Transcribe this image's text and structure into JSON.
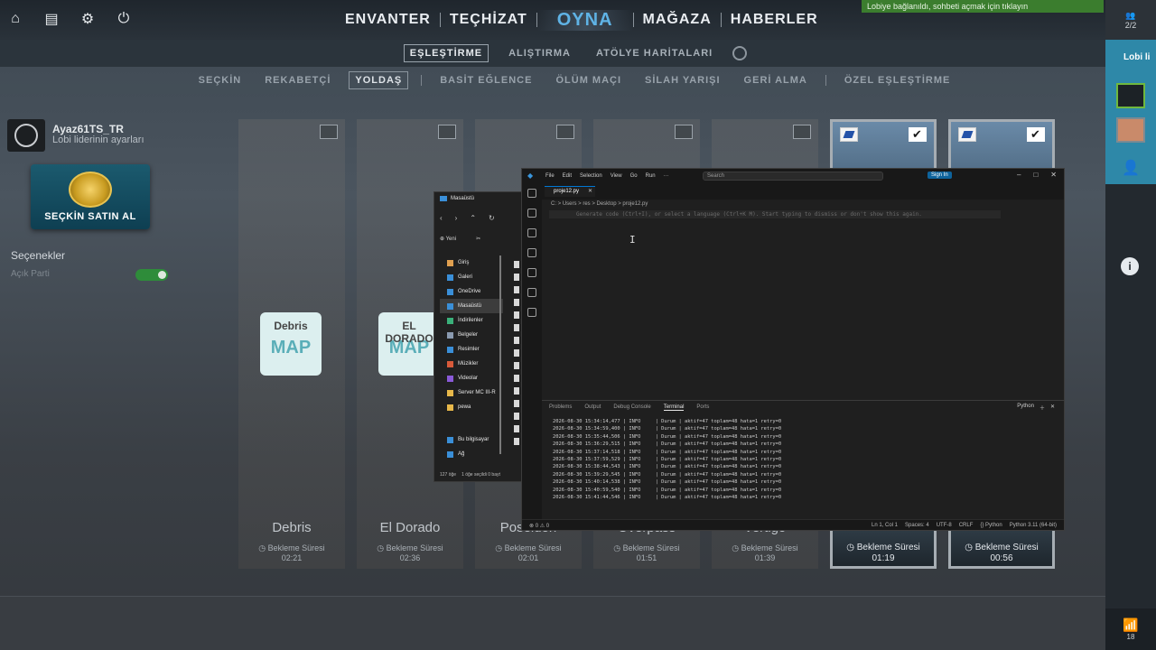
{
  "topbar": {
    "icons": [
      "home-icon",
      "inventory-icon",
      "gear-icon",
      "power-icon"
    ],
    "nav": [
      {
        "label": "ENVANTER"
      },
      {
        "label": "TEÇHİZAT"
      },
      {
        "label": "OYNA"
      },
      {
        "label": "MAĞAZA"
      },
      {
        "label": "HABERLER"
      }
    ],
    "active_index": 2,
    "lobby_banner": "Lobiye bağlanıldı, sohbeti açmak için tıklayın"
  },
  "subnav": {
    "tabs": [
      "EŞLEŞTİRME",
      "ALIŞTIRMA",
      "ATÖLYE HARİTALARI"
    ],
    "active_index": 0
  },
  "modenav": {
    "tabs": [
      "SEÇKİN",
      "REKABETÇİ",
      "YOLDAŞ",
      "BASİT EĞLENCE",
      "ÖLÜM MAÇI",
      "SİLAH YARIŞI",
      "GERİ ALMA",
      "ÖZEL EŞLEŞTİRME"
    ],
    "active_index": 2
  },
  "profile": {
    "username": "Ayaz61TS_TR",
    "subtitle": "Lobi liderinin ayarları",
    "prime_label": "SEÇKİN SATIN AL",
    "options_title": "Seçenekler",
    "open_party": "Açık Parti"
  },
  "maps": [
    {
      "name": "Debris",
      "wait_label": "Bekleme Süresi",
      "time": "02:21",
      "selected": false,
      "sticker": "MAP",
      "sticker_title": "Debris"
    },
    {
      "name": "El Dorado",
      "wait_label": "Bekleme Süresi",
      "time": "02:36",
      "selected": false,
      "sticker": "MAP",
      "sticker_title": "EL DORADO"
    },
    {
      "name": "Poseidon",
      "wait_label": "Bekleme Süresi",
      "time": "02:01",
      "selected": false,
      "sticker": "",
      "sticker_title": ""
    },
    {
      "name": "Overpass",
      "wait_label": "Bekleme Süresi",
      "time": "01:51",
      "selected": false,
      "sticker": "",
      "sticker_title": ""
    },
    {
      "name": "Vertigo",
      "wait_label": "Bekleme Süresi",
      "time": "01:39",
      "selected": false,
      "sticker": "",
      "sticker_title": ""
    },
    {
      "name": "",
      "wait_label": "Bekleme Süresi",
      "time": "01:19",
      "selected": true,
      "sticker": "",
      "sticker_title": ""
    },
    {
      "name": "",
      "wait_label": "Bekleme Süresi",
      "time": "00:56",
      "selected": true,
      "sticker": "",
      "sticker_title": ""
    }
  ],
  "rail": {
    "party_count": "2/2",
    "lobby_label": "Lobi li",
    "signal_count": "18"
  },
  "explorer": {
    "title": "Masaüstü",
    "new_label": "Yeni",
    "items": [
      {
        "label": "Giriş",
        "icon": "home-icon",
        "color": "#e0a050"
      },
      {
        "label": "Galeri",
        "icon": "gallery-icon",
        "color": "#3a8fd8"
      },
      {
        "label": "OneDrive",
        "icon": "cloud-icon",
        "color": "#3a8fd8"
      },
      {
        "label": "Masaüstü",
        "icon": "desktop-icon",
        "color": "#3a8fd8"
      },
      {
        "label": "İndirilenler",
        "icon": "download-icon",
        "color": "#3ab07a"
      },
      {
        "label": "Belgeler",
        "icon": "documents-icon",
        "color": "#8a9ab0"
      },
      {
        "label": "Resimler",
        "icon": "pictures-icon",
        "color": "#3a8fd8"
      },
      {
        "label": "Müzikler",
        "icon": "music-icon",
        "color": "#d85a3a"
      },
      {
        "label": "Videolar",
        "icon": "videos-icon",
        "color": "#8a5ad8"
      },
      {
        "label": "Server MC III-R",
        "icon": "folder-icon",
        "color": "#e8b84a"
      },
      {
        "label": "pewa",
        "icon": "folder-icon",
        "color": "#e8b84a"
      },
      {
        "label": "Bu bilgisayar",
        "icon": "computer-icon",
        "color": "#3a8fd8"
      },
      {
        "label": "Ağ",
        "icon": "network-icon",
        "color": "#3a8fd8"
      }
    ],
    "status_count": "127 öğe",
    "status_selected": "1 öğe seçildi 0 bayt"
  },
  "vscode": {
    "menu": [
      "File",
      "Edit",
      "Selection",
      "View",
      "Go",
      "Run",
      "···"
    ],
    "search": "Search",
    "signin": "Sign In",
    "tab": "proje12.py",
    "breadcrumb": "C: > Users > res > Desktop > proje12.py",
    "line_number": "1",
    "hint": "Generate code (Ctrl+I), or select a language (Ctrl+K M). Start typing to dismiss or don't show this again.",
    "panel_tabs": [
      "Problems",
      "Output",
      "Debug Console",
      "Terminal",
      "Ports"
    ],
    "panel_active": 3,
    "panel_right": "Python",
    "terminal_lines": [
      "2026-08-30 15:34:14,477 | INFO     | Durum | aktif=47 toplam=48 hata=1 retry=0",
      "2026-08-30 15:34:59,400 | INFO     | Durum | aktif=47 toplam=48 hata=1 retry=0",
      "2026-08-30 15:35:44,506 | INFO     | Durum | aktif=47 toplam=48 hata=1 retry=0",
      "2026-08-30 15:36:29,515 | INFO     | Durum | aktif=47 toplam=48 hata=1 retry=0",
      "2026-08-30 15:37:14,518 | INFO     | Durum | aktif=47 toplam=48 hata=1 retry=0",
      "2026-08-30 15:37:59,529 | INFO     | Durum | aktif=47 toplam=48 hata=1 retry=0",
      "2026-08-30 15:38:44,543 | INFO     | Durum | aktif=47 toplam=48 hata=1 retry=0",
      "2026-08-30 15:39:29,545 | INFO     | Durum | aktif=47 toplam=48 hata=1 retry=0",
      "2026-08-30 15:40:14,538 | INFO     | Durum | aktif=47 toplam=48 hata=1 retry=0",
      "2026-08-30 15:40:59,540 | INFO     | Durum | aktif=47 toplam=48 hata=1 retry=0",
      "2026-08-30 15:41:44,546 | INFO     | Durum | aktif=47 toplam=48 hata=1 retry=0"
    ],
    "status_left": [
      "⊗ 0 ⚠ 0"
    ],
    "status_right": [
      "Ln 1, Col 1",
      "Spaces: 4",
      "UTF-8",
      "CRLF",
      "{} Python",
      "Python 3.11 (64-bit)"
    ]
  }
}
